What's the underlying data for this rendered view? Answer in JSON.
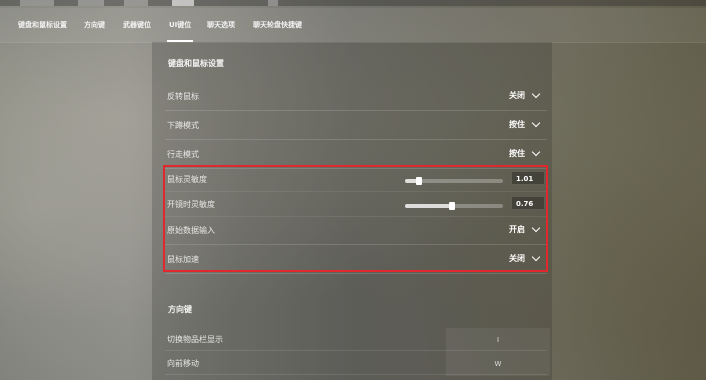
{
  "tabs": [
    {
      "label": "键盘和鼠标设置",
      "active": false
    },
    {
      "label": "方向键",
      "active": false
    },
    {
      "label": "武器键位",
      "active": false
    },
    {
      "label": "UI键位",
      "active": true
    },
    {
      "label": "聊天选项",
      "active": false
    },
    {
      "label": "聊天轮盘快捷键",
      "active": false
    }
  ],
  "section_mouse": {
    "title": "键盘和鼠标设置",
    "invert_mouse": {
      "label": "反转鼠标",
      "value": "关闭"
    },
    "crouch_mode": {
      "label": "下蹲模式",
      "value": "按住"
    },
    "walk_mode": {
      "label": "行走模式",
      "value": "按住"
    },
    "sensitivity": {
      "label": "鼠标灵敏度",
      "value": "1.01",
      "fraction": 0.14
    },
    "zoom_sensitivity": {
      "label": "开镜时灵敏度",
      "value": "0.76",
      "fraction": 0.48
    },
    "raw_input": {
      "label": "原始数据输入",
      "value": "开启"
    },
    "acceleration": {
      "label": "鼠标加速",
      "value": "关闭"
    }
  },
  "section_movement": {
    "title": "方向键",
    "toggle_inventory": {
      "label": "切换物品栏显示",
      "key": "I"
    },
    "move_forward": {
      "label": "向前移动",
      "key": "W"
    }
  },
  "colors": {
    "highlight": "#e0282e"
  }
}
